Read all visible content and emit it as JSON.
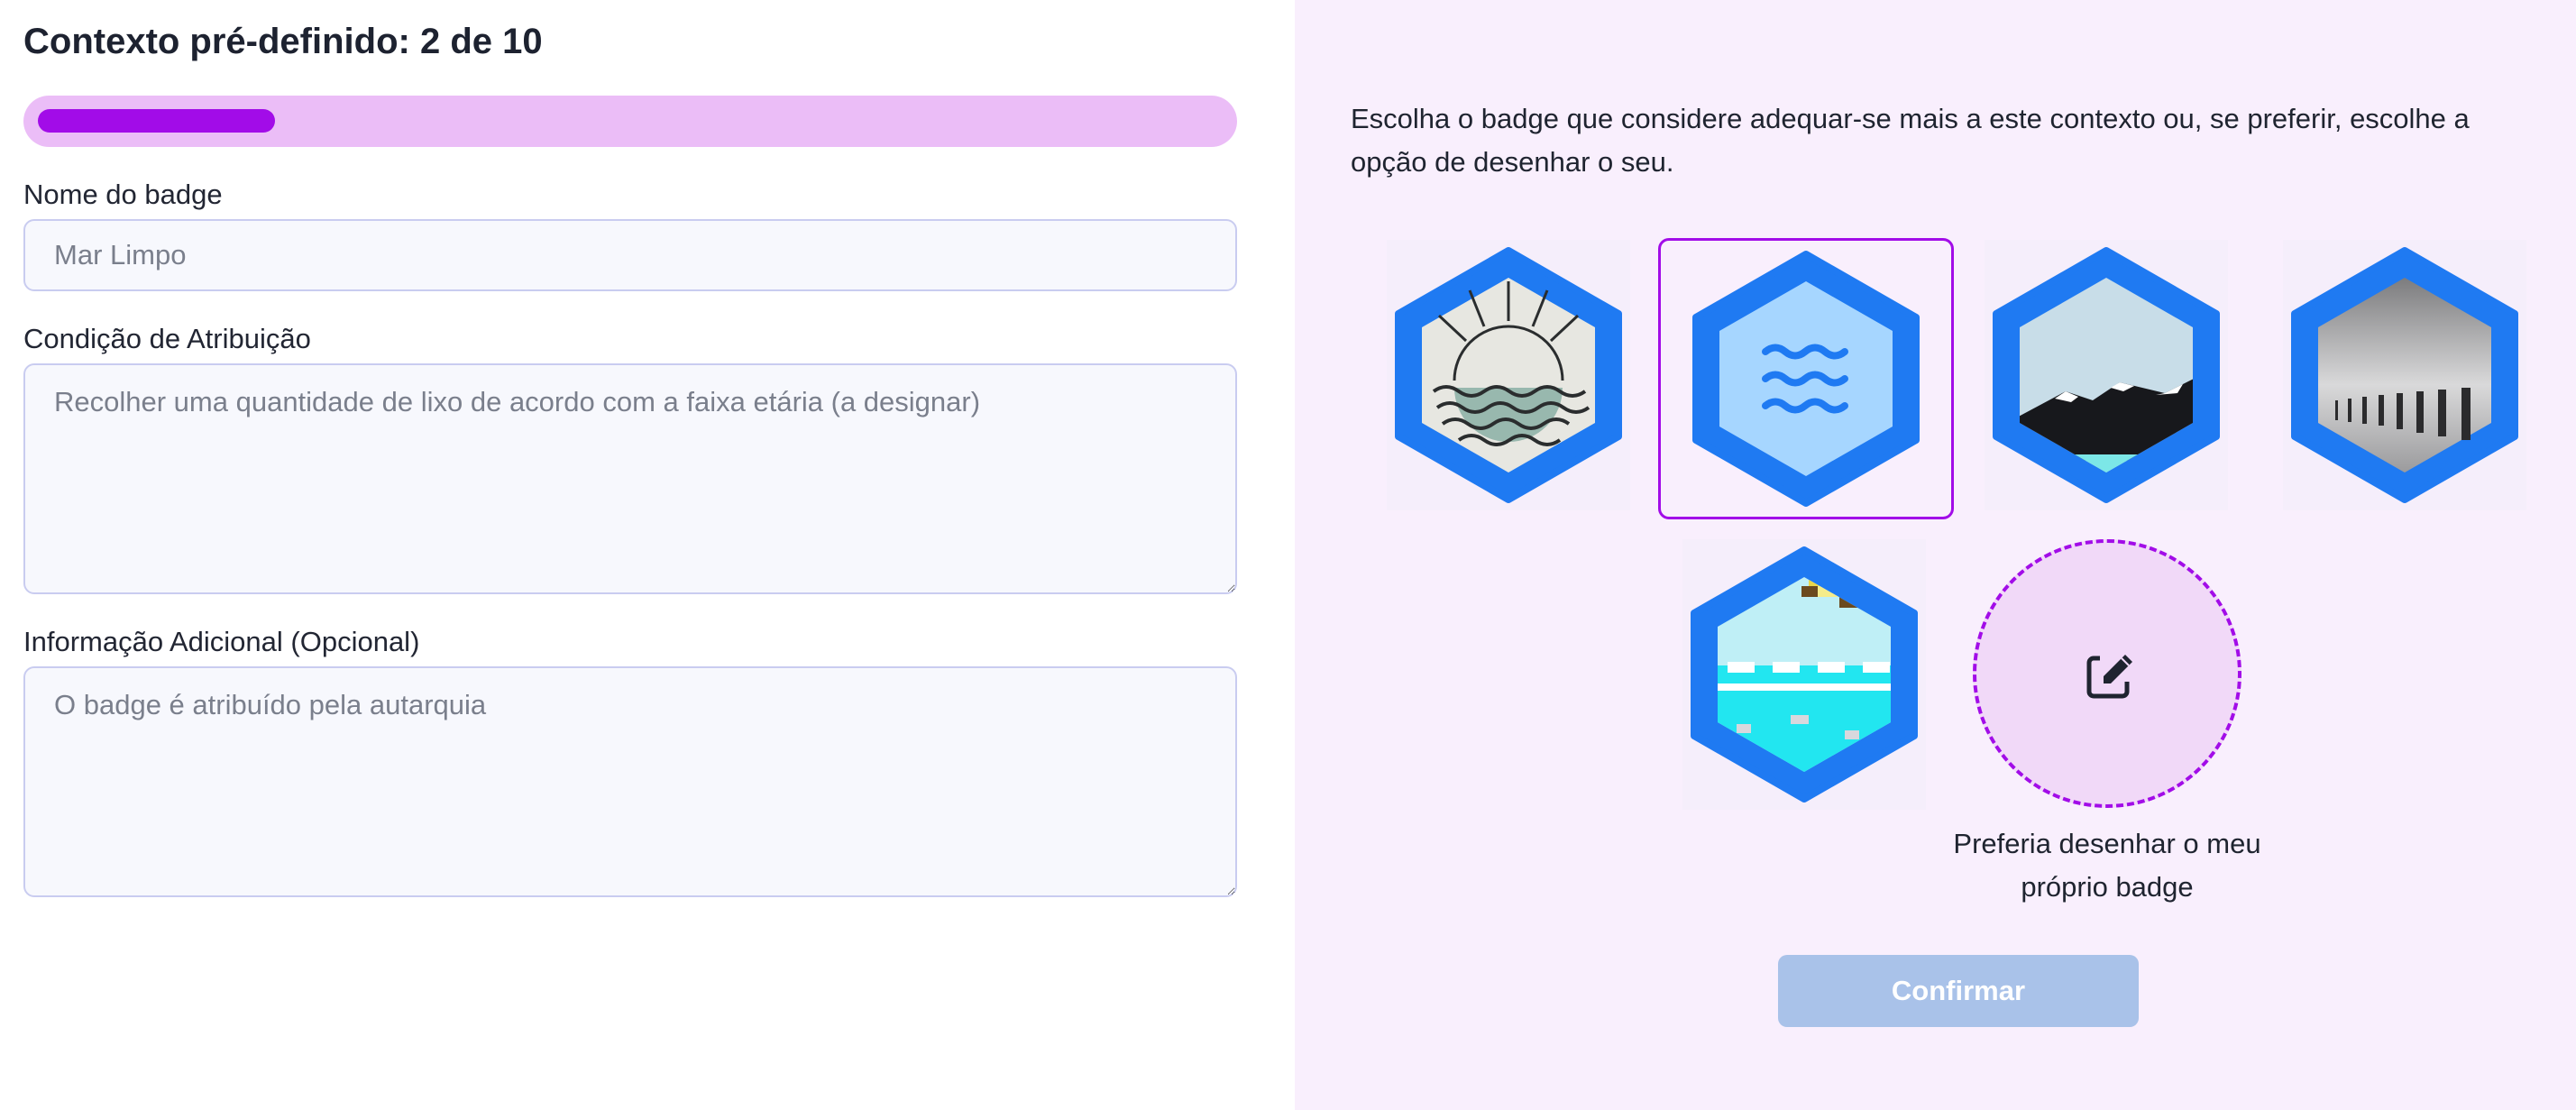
{
  "header": {
    "title": "Contexto pré-definido: 2 de 10"
  },
  "progress": {
    "current": 2,
    "total": 10,
    "fraction": 0.2,
    "track_color": "#ebbdf7",
    "fill_color": "#a20ce8"
  },
  "form": {
    "name": {
      "label": "Nome do badge",
      "placeholder": "Mar Limpo"
    },
    "condition": {
      "label": "Condição de Atribuição",
      "placeholder": "Recolher uma quantidade de lixo de acordo com a faixa etária (a designar)"
    },
    "info": {
      "label": "Informação Adicional (Opcional)",
      "placeholder": "O badge é atribuído pela autarquia"
    }
  },
  "chooser": {
    "intro": "Escolha o badge que considere adequar-se mais a este contexto ou, se preferir, escolhe a opção de desenhar o seu.",
    "badges": [
      {
        "icon": "sun-over-sea-badge-icon",
        "selected": false
      },
      {
        "icon": "waves-badge-icon",
        "selected": true
      },
      {
        "icon": "mountain-badge-icon",
        "selected": false
      },
      {
        "icon": "pier-posts-badge-icon",
        "selected": false
      },
      {
        "icon": "pixel-sea-badge-icon",
        "selected": false
      }
    ],
    "draw_option": {
      "icon": "edit-icon",
      "caption": "Preferia desenhar o meu próprio badge"
    },
    "confirm_label": "Confirmar"
  },
  "colors": {
    "accent": "#a20ce8",
    "badge_frame": "#1f7af2",
    "right_background": "#f9effd",
    "confirm_disabled": "#a9c2e9"
  }
}
